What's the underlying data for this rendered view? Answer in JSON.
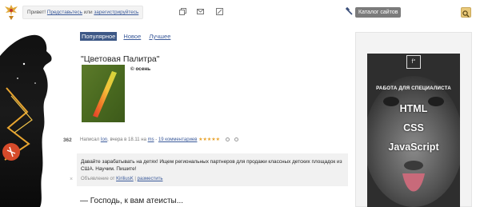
{
  "header": {
    "greeting_prefix": "Привет!",
    "login_link": "Представьтесь",
    "or_text": "или",
    "register_link": "зарегистрируйтесь",
    "catalog_label": "Каталог сайтов",
    "icons": [
      "copy-icon",
      "mail-icon",
      "edit-icon",
      "wrench-icon",
      "search-icon"
    ]
  },
  "tabs": [
    {
      "label": "Популярное",
      "active": true
    },
    {
      "label": "Новое",
      "active": false
    },
    {
      "label": "Лучшее",
      "active": false
    }
  ],
  "post": {
    "title": "\"Цветовая Палитра\"",
    "caption": "© осень",
    "rating": "362",
    "meta": {
      "prefix": "Написал",
      "author": "Ion",
      "time": ", вчера в 18.11 на",
      "site": "ms",
      "sep": " - ",
      "comments": "19 комментариев",
      "stars": "★★★★★"
    }
  },
  "ad": {
    "text": "Давайте зарабатывать на детях! Ищем региональных партнеров для продажи классных детских площадок из США. Научим. Пишите!",
    "foot_prefix": "Объявление от",
    "advertiser": "KiriliusK",
    "foot_sep": " | ",
    "place_link": "разместить",
    "close": "×"
  },
  "teaser": "— Господь, к вам атеисты...",
  "banner": {
    "logo": "f°",
    "subtitle": "РАБОТА ДЛЯ СПЕЦИАЛИСТА",
    "lines": [
      "HTML",
      "CSS",
      "JavaScript"
    ]
  },
  "colors": {
    "accent": "#3d5886",
    "link": "#3b5a9a",
    "catalog_bg": "#7b7b7b",
    "search_bg": "#e8c879",
    "stars": "#e8a22a"
  }
}
